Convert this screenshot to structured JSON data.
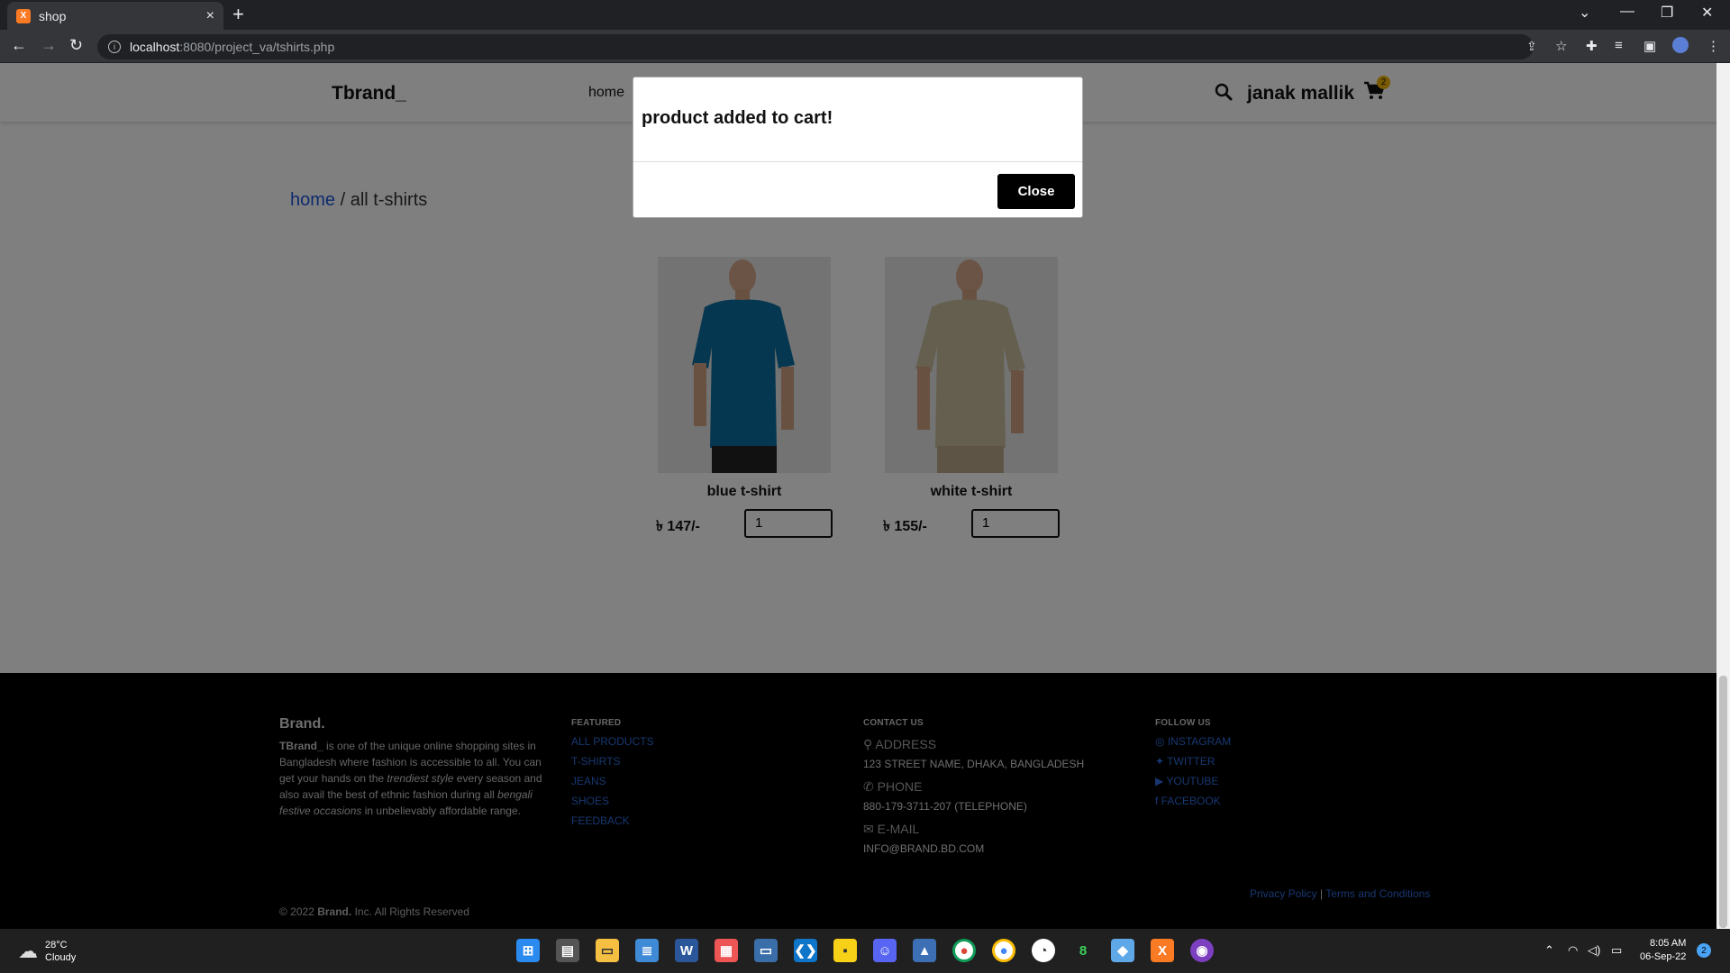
{
  "browser": {
    "tab_title": "shop",
    "tab_close": "×",
    "new_tab": "+",
    "url_host": "localhost",
    "url_path": ":8080/project_va/tshirts.php"
  },
  "header": {
    "logo": "Tbrand_",
    "nav_home": "home",
    "username": "janak mallik",
    "cart_count": "2"
  },
  "breadcrumb": {
    "home": "home",
    "separator": " / ",
    "current": "all t-shirts"
  },
  "products": [
    {
      "name": "blue t-shirt",
      "price": "৳ 147/-",
      "qty": "1",
      "shirt_color": "#0a6ea0"
    },
    {
      "name": "white t-shirt",
      "price": "৳ 155/-",
      "qty": "1",
      "shirt_color": "#c9bf9f"
    }
  ],
  "modal": {
    "message": "product added to cart!",
    "close_label": "Close"
  },
  "footer": {
    "brand_title": "Brand.",
    "brand_name": "TBrand_",
    "brand_desc_1": " is one of the unique online shopping sites in Bangladesh where fashion is accessible to all. You can get your hands on the ",
    "brand_desc_em1": "trendiest style",
    "brand_desc_2": " every season and also avail the best of ethnic fashion during all ",
    "brand_desc_em2": "bengali festive occasions",
    "brand_desc_3": " in unbelievably affordable range.",
    "featured_title": "FEATURED",
    "featured_links": [
      "ALL PRODUCTS",
      "T-SHIRTS",
      "JEANS",
      "SHOES",
      "FEEDBACK"
    ],
    "contact_title": "CONTACT US",
    "address_label": "ADDRESS",
    "address_value": "123 STREET NAME, DHAKA, BANGLADESH",
    "phone_label": "PHONE",
    "phone_value": "880-179-3711-207 (TELEPHONE)",
    "email_label": "E-MAIL",
    "email_value": "INFO@BRAND.BD.COM",
    "follow_title": "FOLLOW US",
    "follow_links": [
      "INSTAGRAM",
      "TWITTER",
      "YOUTUBE",
      "FACEBOOK"
    ],
    "privacy": "Privacy Policy",
    "terms": "Terms and Conditions",
    "copyright_pre": "© 2022 ",
    "copyright_brand": "Brand.",
    "copyright_post": " Inc. All Rights Reserved"
  },
  "taskbar": {
    "temp": "28°C",
    "condition": "Cloudy",
    "time": "8:05 AM",
    "date": "06-Sep-22",
    "notifications": "2"
  }
}
